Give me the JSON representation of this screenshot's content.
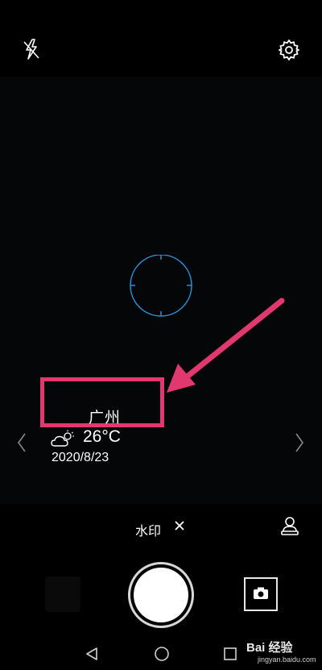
{
  "viewfinder_watermark": {
    "city": "广州",
    "temperature": "26°C",
    "date": "2020/8/23",
    "weather_icon": "partly-cloudy-icon"
  },
  "bottom": {
    "watermark_label": "水印",
    "watermark_close_icon": "close-icon",
    "stamp_icon": "person-stamp-icon"
  },
  "icons": {
    "flash": "flash-off-icon",
    "settings": "gear-icon",
    "switch_camera": "switch-camera-icon"
  },
  "baidu_watermark": {
    "main": "Bai 经验",
    "sub": "jingyan.baidu.com"
  },
  "colors": {
    "annotation": "#e0386f",
    "focus_ring": "#2a8fd6"
  }
}
